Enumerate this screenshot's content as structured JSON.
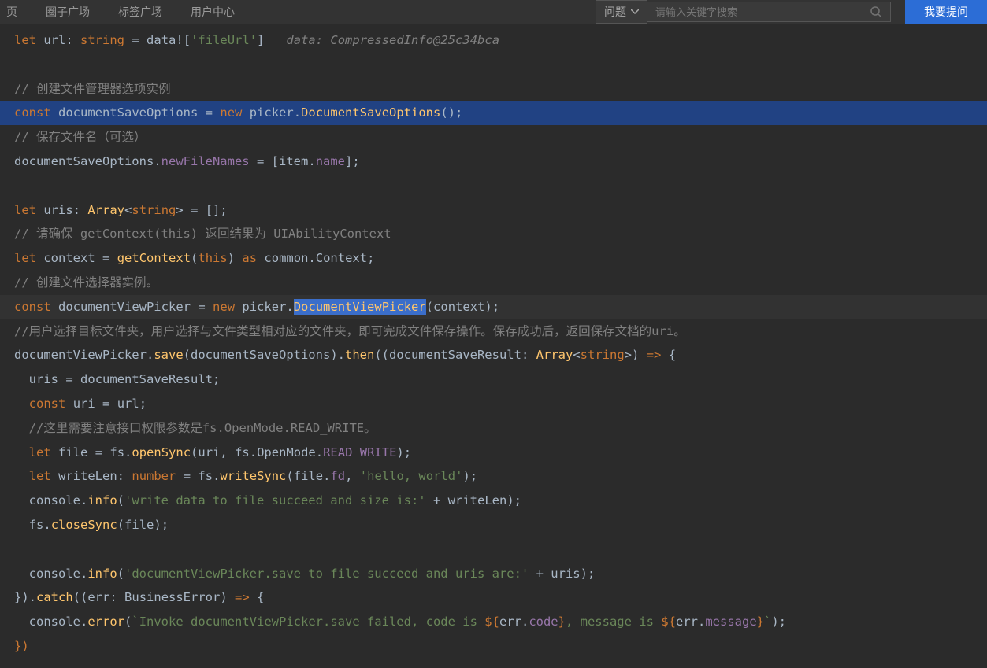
{
  "nav": {
    "links": [
      "页",
      "圈子广场",
      "标签广场",
      "用户中心"
    ],
    "dropdown": "问题",
    "search_placeholder": "请输入关键字搜索",
    "ask": "我要提问"
  },
  "code": {
    "l1": {
      "kw1": "let",
      "var1": "url",
      "type": "string",
      "op": "=",
      "var2": "data",
      "punc1": "!",
      "punc2": "[",
      "str": "'fileUrl'",
      "punc3": "]",
      "hint": "data: CompressedInfo@25c34bca"
    },
    "l3": {
      "cmt": "// 创建文件管理器选项实例"
    },
    "l4": {
      "kw1": "const",
      "var1": "documentSaveOptions",
      "op": "=",
      "kw2": "new",
      "var2": "picker",
      "punc1": ".",
      "type": "DocumentSaveOptions",
      "punc2": "();"
    },
    "l5": {
      "cmt": "// 保存文件名（可选）"
    },
    "l6": {
      "var1": "documentSaveOptions",
      "punc1": ".",
      "prop": "newFileNames",
      "op": "=",
      "punc2": "[",
      "var2": "item",
      "punc3": ".",
      "prop2": "name",
      "punc4": "];"
    },
    "l8": {
      "kw1": "let",
      "var1": "uris",
      "punc1": ":",
      "type": "Array",
      "punc2": "<",
      "type2": "string",
      "punc3": ">",
      "op": "=",
      "punc4": "[];"
    },
    "l9": {
      "cmt": "// 请确保 getContext(this) 返回结果为 UIAbilityContext"
    },
    "l10": {
      "kw1": "let",
      "var1": "context",
      "op": "=",
      "fn": "getContext",
      "punc1": "(",
      "this": "this",
      "punc2": ")",
      "kw2": "as",
      "var2": "common",
      "punc3": ".",
      "type": "Context",
      "punc4": ";"
    },
    "l11": {
      "cmt": "// 创建文件选择器实例。"
    },
    "l12": {
      "kw1": "const",
      "var1": "documentViewPicker",
      "op": "=",
      "kw2": "new",
      "var2": "picker",
      "punc1": ".",
      "type": "DocumentViewPicker",
      "punc2": "(",
      "var3": "context",
      "punc3": ");"
    },
    "l13": {
      "cmt": "//用户选择目标文件夹，用户选择与文件类型相对应的文件夹，即可完成文件保存操作。保存成功后，返回保存文档的uri。"
    },
    "l14": {
      "var1": "documentViewPicker",
      "punc1": ".",
      "fn": "save",
      "punc2": "(",
      "var2": "documentSaveOptions",
      "punc3": ").",
      "fn2": "then",
      "punc4": "((",
      "var3": "documentSaveResult",
      "punc5": ":",
      "type": "Array",
      "punc6": "<",
      "type2": "string",
      "punc7": ">)",
      "arrow": "=>",
      "punc8": "{"
    },
    "l15": {
      "var1": "uris",
      "op": "=",
      "var2": "documentSaveResult",
      "punc": ";"
    },
    "l16": {
      "kw1": "const",
      "var1": "uri",
      "op": "=",
      "var2": "url",
      "punc": ";"
    },
    "l17": {
      "cmt": "//这里需要注意接口权限参数是fs.OpenMode.READ_WRITE。"
    },
    "l18": {
      "kw1": "let",
      "var1": "file",
      "op": "=",
      "var2": "fs",
      "punc1": ".",
      "fn": "openSync",
      "punc2": "(",
      "var3": "uri",
      "punc3": ",",
      "var4": "fs",
      "punc4": ".",
      "prop": "OpenMode",
      "punc5": ".",
      "prop2": "READ_WRITE",
      "punc6": ");"
    },
    "l19": {
      "kw1": "let",
      "var1": "writeLen",
      "punc1": ":",
      "type": "number",
      "op": "=",
      "var2": "fs",
      "punc2": ".",
      "fn": "writeSync",
      "punc3": "(",
      "var3": "file",
      "punc4": ".",
      "prop": "fd",
      "punc5": ",",
      "str": "'hello, world'",
      "punc6": ");"
    },
    "l20": {
      "var1": "console",
      "punc1": ".",
      "fn": "info",
      "punc2": "(",
      "str": "'write data to file succeed and size is:'",
      "op": "+",
      "var2": "writeLen",
      "punc3": ");"
    },
    "l21": {
      "var1": "fs",
      "punc1": ".",
      "fn": "closeSync",
      "punc2": "(",
      "var2": "file",
      "punc3": ");"
    },
    "l23": {
      "var1": "console",
      "punc1": ".",
      "fn": "info",
      "punc2": "(",
      "str": "'documentViewPicker.save to file succeed and uris are:'",
      "op": "+",
      "var2": "uris",
      "punc3": ");"
    },
    "l24": {
      "punc1": "}).",
      "fn": "catch",
      "punc2": "((",
      "var1": "err",
      "punc3": ":",
      "type": "BusinessError",
      "punc4": ")",
      "arrow": "=>",
      "punc5": "{"
    },
    "l25": {
      "var1": "console",
      "punc1": ".",
      "fn": "error",
      "punc2": "(",
      "str1": "`Invoke documentViewPicker.save failed, code is ",
      "punc3": "${",
      "var2": "err",
      "punc4": ".",
      "prop1": "code",
      "punc5": "}",
      "str2": ", message is ",
      "punc6": "${",
      "var3": "err",
      "punc7": ".",
      "prop2": "message",
      "punc8": "}",
      "str3": "`",
      "punc9": ");"
    },
    "l26": {
      "punc": "})"
    }
  }
}
